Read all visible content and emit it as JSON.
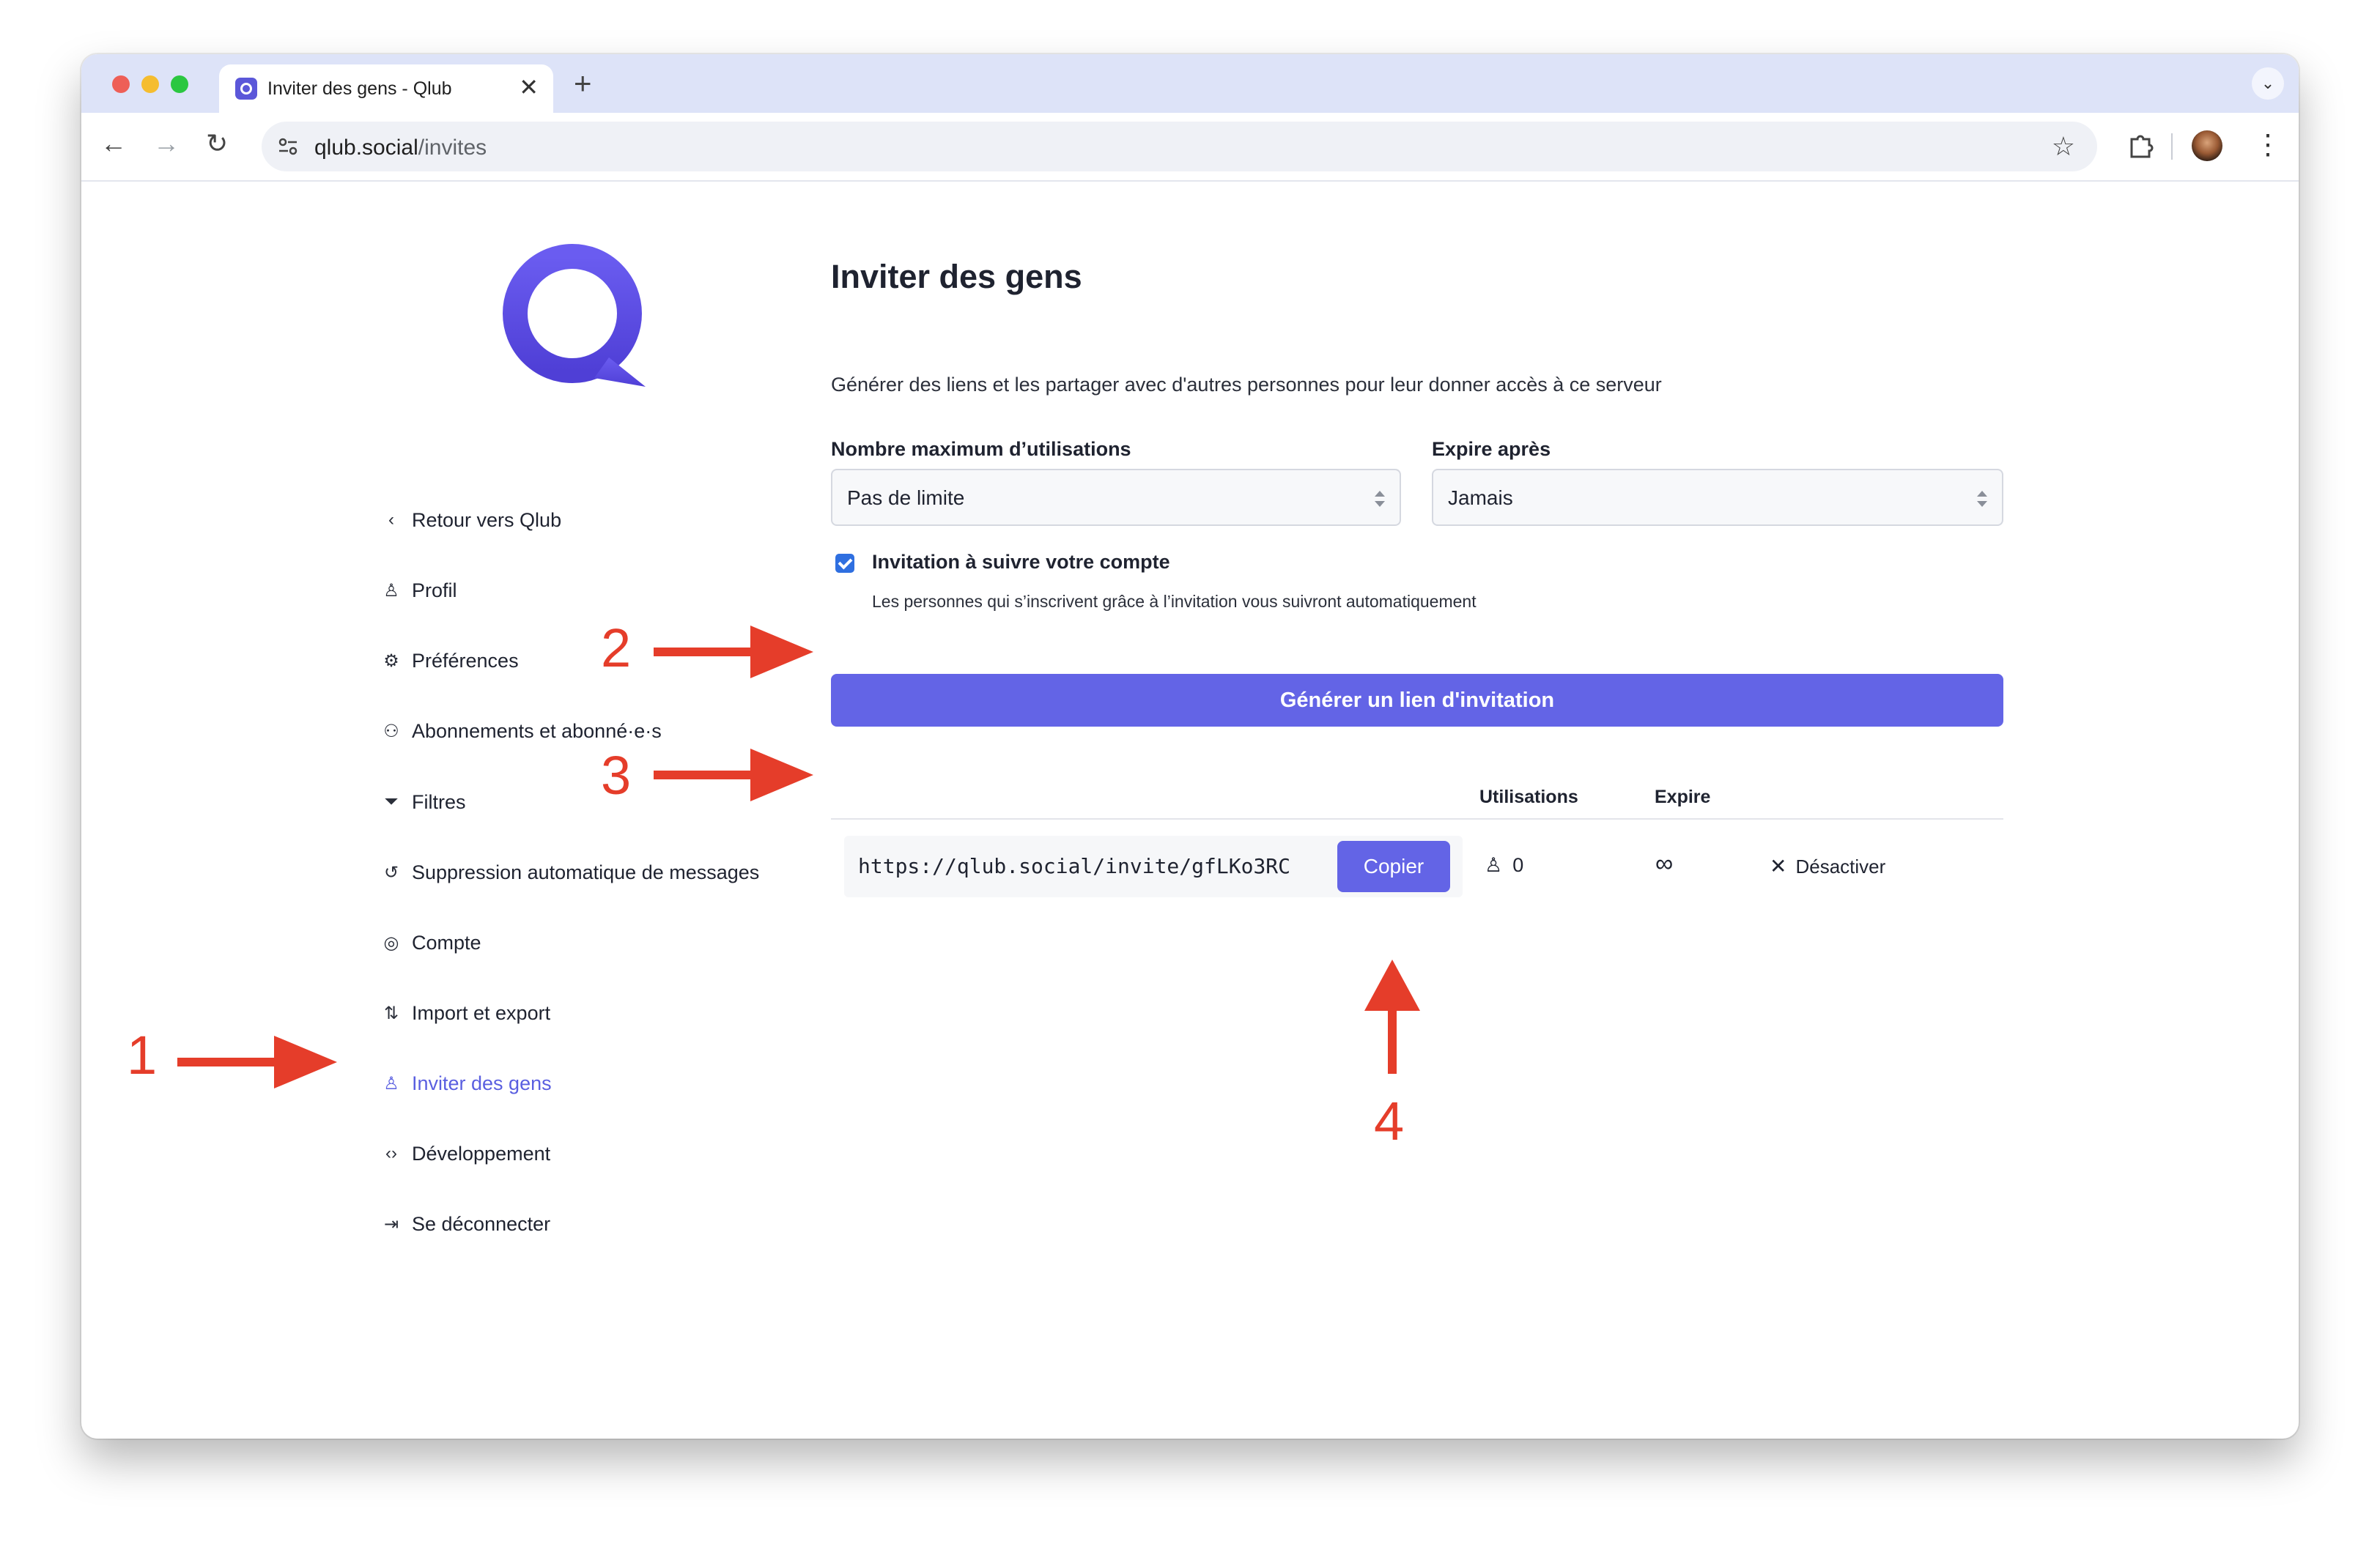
{
  "browser": {
    "tab_title": "Inviter des gens - Qlub",
    "url_host": "qlub.social",
    "url_path": "/invites",
    "new_tab": "+",
    "tab_close": "✕"
  },
  "sidebar": {
    "items": [
      {
        "label": "Retour vers Qlub",
        "icon": "chevron-left-icon",
        "glyph": "‹"
      },
      {
        "label": "Profil",
        "icon": "user-icon",
        "glyph": "♙"
      },
      {
        "label": "Préférences",
        "icon": "gear-icon",
        "glyph": "⚙"
      },
      {
        "label": "Abonnements et abonné·e·s",
        "icon": "users-icon",
        "glyph": "⚇"
      },
      {
        "label": "Filtres",
        "icon": "filter-icon",
        "glyph": "⏷"
      },
      {
        "label": "Suppression automatique de messages",
        "icon": "history-icon",
        "glyph": "↺"
      },
      {
        "label": "Compte",
        "icon": "account-icon",
        "glyph": "◎"
      },
      {
        "label": "Import et export",
        "icon": "import-export-icon",
        "glyph": "⇅"
      },
      {
        "label": "Inviter des gens",
        "icon": "user-plus-icon",
        "glyph": "♙"
      },
      {
        "label": "Développement",
        "icon": "code-icon",
        "glyph": "‹›"
      },
      {
        "label": "Se déconnecter",
        "icon": "logout-icon",
        "glyph": "⇥"
      }
    ],
    "active_index": 8
  },
  "main": {
    "title": "Inviter des gens",
    "description": "Générer des liens et les partager avec d'autres personnes pour leur donner accès à ce serveur",
    "max_uses_label": "Nombre maximum d’utilisations",
    "max_uses_value": "Pas de limite",
    "expires_label": "Expire après",
    "expires_value": "Jamais",
    "autofollow_label": "Invitation à suivre votre compte",
    "autofollow_hint": "Les personnes qui s’inscrivent grâce à l’invitation vous suivront automatiquement",
    "autofollow_checked": true,
    "generate_button": "Générer un lien d'invitation"
  },
  "invites_table": {
    "headers": {
      "uses": "Utilisations",
      "expires": "Expire"
    },
    "rows": [
      {
        "link": "https://qlub.social/invite/gfLKo3RC",
        "copy_label": "Copier",
        "uses": "0",
        "expires": "∞",
        "deactivate_label": "Désactiver"
      }
    ]
  },
  "annotations": [
    "1",
    "2",
    "3",
    "4"
  ],
  "colors": {
    "accent": "#6364e6",
    "annotation": "#e53d2a",
    "tabbar": "#dde3f8",
    "checkbox": "#2f6fe0"
  }
}
